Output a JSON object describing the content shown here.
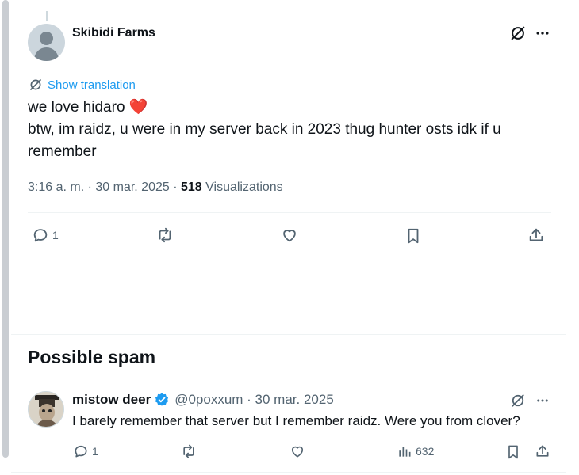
{
  "tweet": {
    "author_name": "Skibidi Farms",
    "translate_label": "Show translation",
    "text_line1": "we love hidaro",
    "text_line1_emoji": "❤️",
    "text_line2": "btw, im raidz, u were in my server back in 2023 thug hunter osts idk if u remember",
    "meta_time": "3:16 a. m. · 30 mar. 2025 · ",
    "meta_views_count": "518",
    "meta_views_label": "Visualizations",
    "reply_count": "1"
  },
  "section": {
    "title": "Possible spam"
  },
  "reply": {
    "author_name": "mistow deer",
    "handle_date": "@0poxxum · 30 mar. 2025",
    "text": "I barely remember that server but I remember raidz. Were you from clover?",
    "reply_count": "1",
    "views_count": "632"
  },
  "icons": {
    "more": "more-dots-icon",
    "grok": "grok-icon",
    "reply": "reply-bubble-icon",
    "retweet": "retweet-icon",
    "like": "heart-icon",
    "bookmark": "bookmark-icon",
    "share": "share-upload-icon",
    "views": "views-bars-icon",
    "verified": "verified-badge-icon"
  },
  "colors": {
    "accent": "#1d9bf0",
    "heart": "#f4212e",
    "secondary_text": "#536471",
    "primary_text": "#0f1419"
  }
}
